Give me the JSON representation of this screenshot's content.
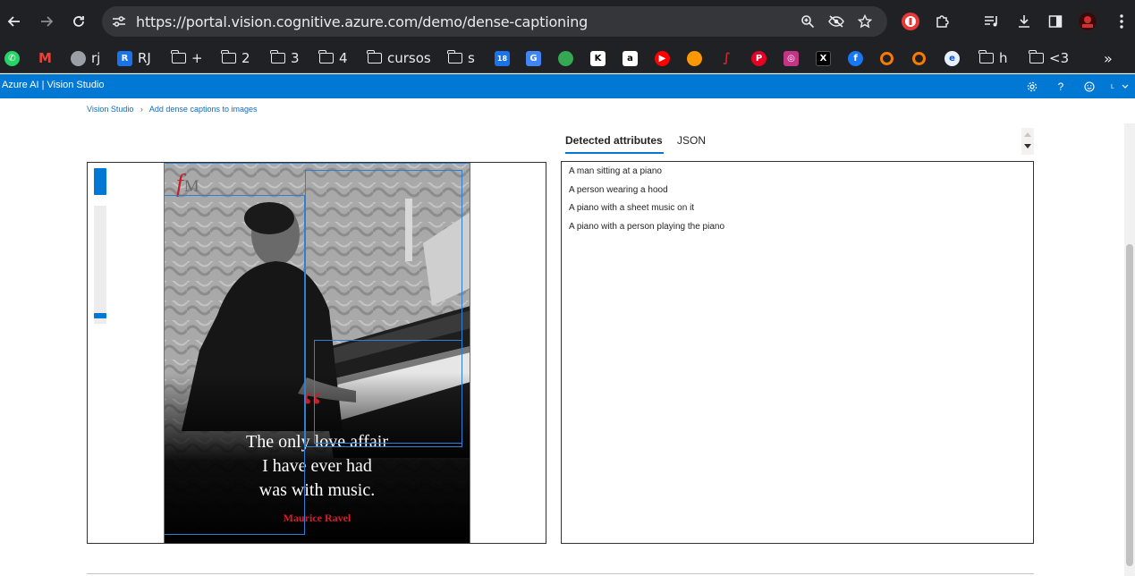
{
  "browser": {
    "url": "https://portal.vision.cognitive.azure.com/demo/dense-captioning",
    "nav": {
      "back_icon": "back-arrow-icon",
      "forward_icon": "forward-arrow-icon",
      "reload_icon": "reload-icon"
    }
  },
  "bookmarks": [
    {
      "label": "",
      "icon": "whatsapp-icon",
      "color": "#25d366"
    },
    {
      "label": "",
      "icon": "gmail-icon",
      "color": "#ea4335"
    },
    {
      "label": "rj",
      "icon": "globe-icon",
      "color": "#9aa0a6"
    },
    {
      "label": "RJ",
      "icon": "app-icon",
      "color": "#1a73e8"
    },
    {
      "label": "+",
      "icon": "folder-icon"
    },
    {
      "label": "2",
      "icon": "folder-icon"
    },
    {
      "label": "3",
      "icon": "folder-icon"
    },
    {
      "label": "4",
      "icon": "folder-icon"
    },
    {
      "label": "cursos",
      "icon": "folder-icon"
    },
    {
      "label": "s",
      "icon": "folder-icon"
    },
    {
      "label": "18",
      "icon": "calendar-icon"
    }
  ],
  "azure": {
    "title": "Azure AI  |  Vision Studio"
  },
  "breadcrumb": {
    "home": "Vision Studio",
    "current": "Add dense captions to images"
  },
  "poster": {
    "quote_lines": [
      "The only love affair",
      "I have ever had",
      "was with music."
    ],
    "author": "Maurice Ravel",
    "logo_f": "f",
    "logo_m": "M",
    "quote_mark": "“"
  },
  "tabs": {
    "attributes": "Detected attributes",
    "json": "JSON"
  },
  "results": [
    "A man sitting at a piano",
    "A person wearing a hood",
    "A piano with a sheet music on it",
    "A piano with a person playing the piano"
  ]
}
